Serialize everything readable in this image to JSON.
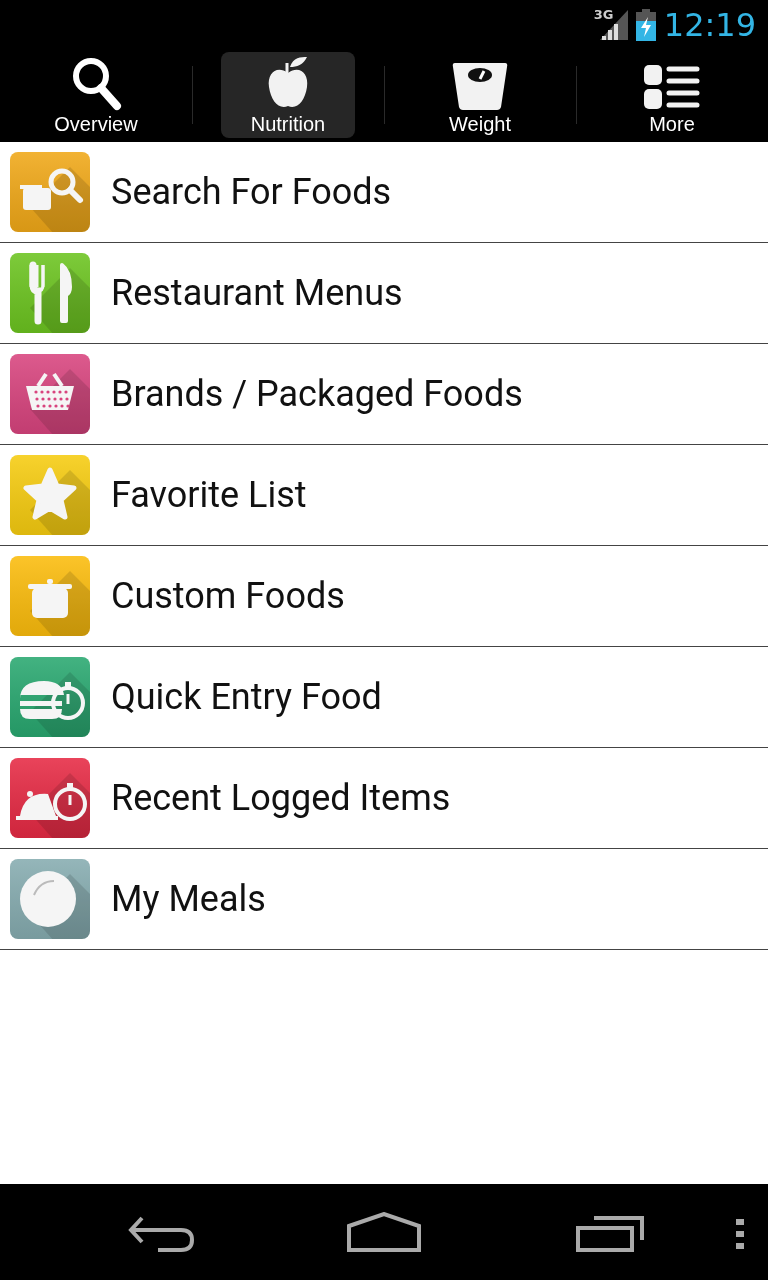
{
  "status_bar": {
    "network": "3G",
    "time": "12:19"
  },
  "tabs": [
    {
      "label": "Overview",
      "selected": false
    },
    {
      "label": "Nutrition",
      "selected": true
    },
    {
      "label": "Weight",
      "selected": false
    },
    {
      "label": "More",
      "selected": false
    }
  ],
  "menu_items": [
    {
      "label": "Search For Foods",
      "color": "#f0a818"
    },
    {
      "label": "Restaurant Menus",
      "color": "#6cc420"
    },
    {
      "label": "Brands / Packaged Foods",
      "color": "#d8447e"
    },
    {
      "label": "Favorite List",
      "color": "#f6cc10"
    },
    {
      "label": "Custom Foods",
      "color": "#fbbc0c"
    },
    {
      "label": "Quick Entry Food",
      "color": "#29a870"
    },
    {
      "label": "Recent Logged Items",
      "color": "#e62a44"
    },
    {
      "label": "My Meals",
      "color": "#86acb0"
    }
  ]
}
